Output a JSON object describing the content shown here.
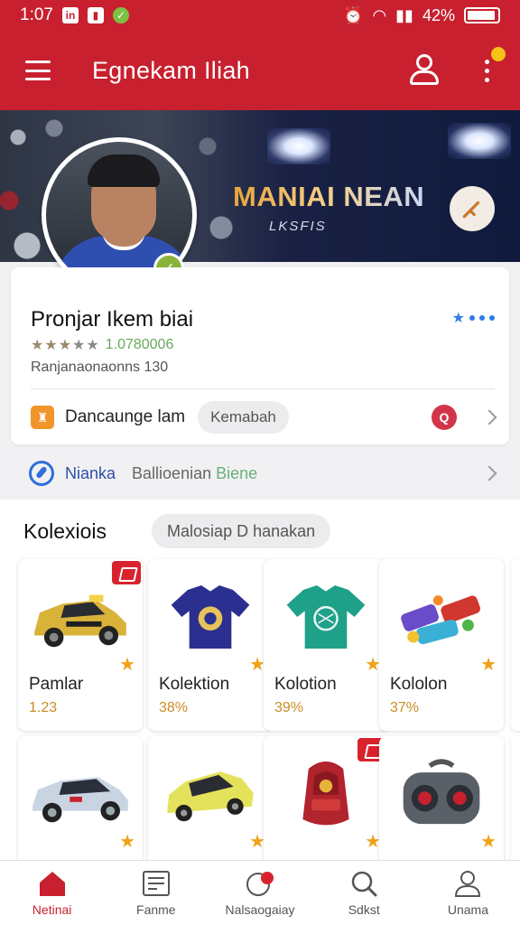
{
  "status_bar": {
    "time": "1:07",
    "battery": "42%"
  },
  "app_bar": {
    "title": "Egnekam Iliah"
  },
  "banner": {
    "title": "MANIAI NEAN",
    "subtitle": "LKSFIS"
  },
  "profile": {
    "name": "Pronjar Ikem biai",
    "rating_count": "1.0780006",
    "meta": "Ranjanaonaonns 130",
    "category_label": "Dancaunge lam",
    "category_chip": "Kemabah",
    "rating_stars": 3
  },
  "nav_row": {
    "main": "Nianka",
    "sub": "Ballioenian",
    "sub_accent": "Biene"
  },
  "collections": {
    "title": "Kolexiois",
    "chip": "Malosiap D hanakan",
    "items": [
      {
        "name": "Pamlar",
        "value": "1.23",
        "tagged": true
      },
      {
        "name": "Kolektion",
        "value": "38%",
        "tagged": false
      },
      {
        "name": "Kolotion",
        "value": "39%",
        "tagged": false
      },
      {
        "name": "Kololon",
        "value": "37%",
        "tagged": false
      },
      {
        "name": "",
        "value": "",
        "tagged": false
      },
      {
        "name": "",
        "value": "",
        "tagged": false
      },
      {
        "name": "",
        "value": "",
        "tagged": true
      },
      {
        "name": "",
        "value": "",
        "tagged": false
      }
    ]
  },
  "bottom_nav": [
    {
      "label": "Netinai",
      "icon": "home-icon",
      "active": true
    },
    {
      "label": "Fanme",
      "icon": "list-icon",
      "active": false
    },
    {
      "label": "Nalsaogaiay",
      "icon": "activity-icon",
      "active": false
    },
    {
      "label": "Sdkst",
      "icon": "search-icon",
      "active": false
    },
    {
      "label": "Unama",
      "icon": "user-icon",
      "active": false
    }
  ],
  "colors": {
    "brand_red": "#c8202f",
    "accent_blue": "#2f7de1",
    "star_gold": "#f0a21a"
  }
}
